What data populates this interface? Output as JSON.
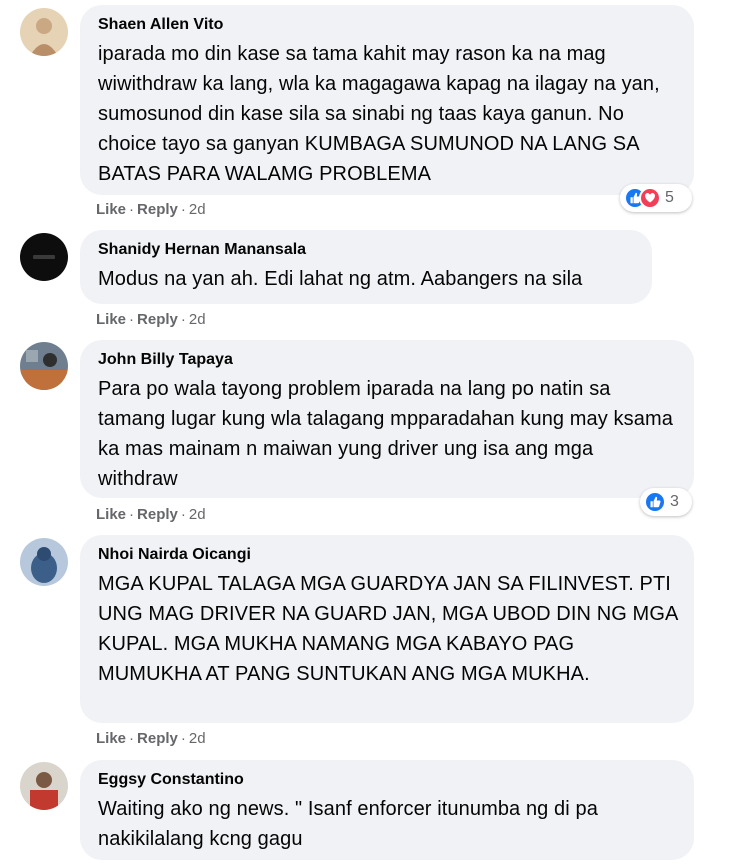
{
  "actions": {
    "like": "Like",
    "reply": "Reply",
    "separator": "·"
  },
  "colors": {
    "bubble": "#f0f2f5",
    "like_blue": "#1877f2",
    "love_red": "#f33e58",
    "meta_grey": "#65676b"
  },
  "comments": [
    {
      "author": "Shaen Allen Vito",
      "text": "iparada mo din kase sa tama kahit may rason ka na mag wiwithdraw ka lang, wla ka magagawa kapag na ilagay na yan, sumosunod din kase sila sa sinabi ng taas kaya ganun. No choice tayo sa ganyan KUMBAGA SUMUNOD NA LANG SA BATAS PARA WALAMG PROBLEMA",
      "time": "2d",
      "reactions": {
        "icons": [
          "like-icon",
          "love-icon"
        ],
        "count": "5"
      }
    },
    {
      "author": "Shanidy Hernan Manansala",
      "text": "Modus na yan ah. Edi lahat ng atm. Aabangers na sila",
      "time": "2d"
    },
    {
      "author": "John Billy Tapaya",
      "text": "Para po wala tayong problem iparada na lang po natin sa tamang lugar kung wla talagang mpparadahan kung may ksama ka mas mainam n maiwan yung driver ung isa ang mga withdraw",
      "time": "2d",
      "reactions": {
        "icons": [
          "like-icon"
        ],
        "count": "3"
      }
    },
    {
      "author": "Nhoi Nairda Oicangi",
      "text": "MGA KUPAL TALAGA MGA GUARDYA JAN SA FILINVEST. PTI UNG MAG DRIVER NA GUARD JAN, MGA UBOD DIN NG MGA KUPAL. MGA MUKHA NAMANG MGA KABAYO PAG MUMUKHA AT PANG SUNTUKAN ANG MGA MUKHA.",
      "time": "2d"
    },
    {
      "author": "Eggsy Constantino",
      "text": "Waiting ako ng news. \" Isanf enforcer itunumba ng di pa nakikilalang kcng gagu"
    }
  ]
}
